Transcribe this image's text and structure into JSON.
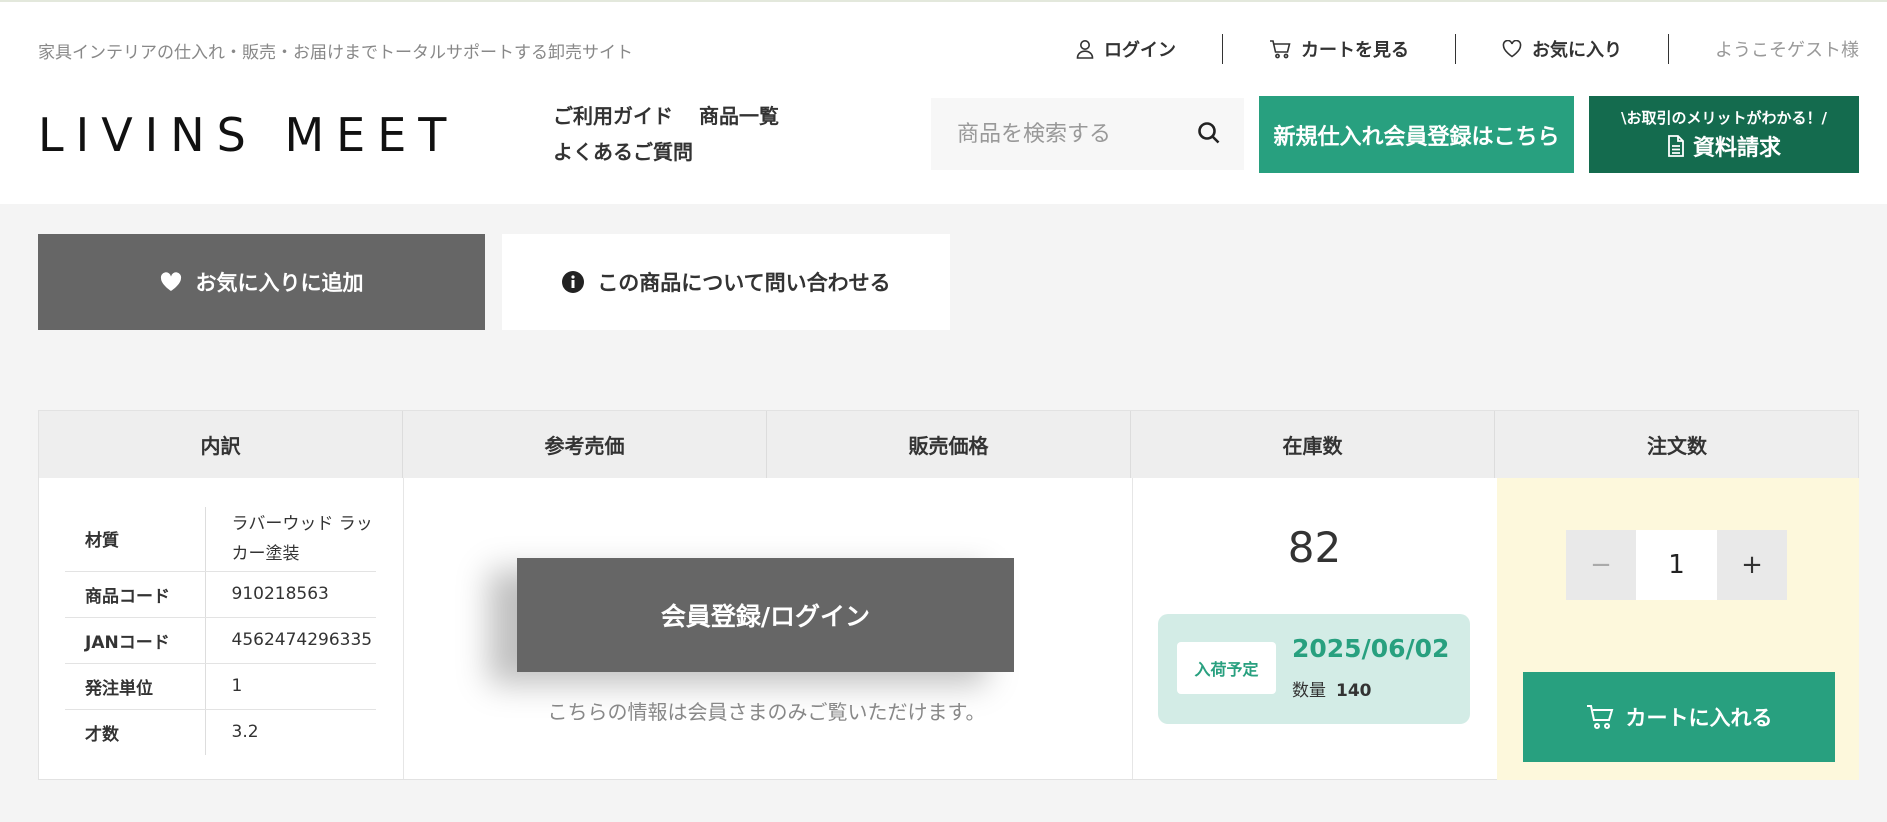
{
  "header": {
    "tagline": "家具インテリアの仕入れ・販売・お届けまでトータルサポートする卸売サイト",
    "logo_text": "LIVINS MEET",
    "util_nav": {
      "login": "ログイン",
      "cart": "カートを見る",
      "favorites": "お気に入り",
      "welcome": "ようこそゲスト様"
    },
    "main_nav": [
      "ご利用ガイド",
      "商品一覧",
      "よくあるご質問"
    ],
    "search": {
      "placeholder": "商品を検索する"
    },
    "register_button": "新規仕入れ会員登録はこちら",
    "docs_button": {
      "sub": "\\お取引のメリットがわかる！/",
      "main": "資料請求"
    }
  },
  "actions": {
    "favorite": "お気に入りに追加",
    "inquiry": "この商品について問い合わせる"
  },
  "table": {
    "headers": [
      "内訳",
      "参考売価",
      "販売価格",
      "在庫数",
      "注文数"
    ],
    "spec": [
      {
        "key": "材質",
        "value": "ラバーウッド ラッカー塗装"
      },
      {
        "key": "商品コード",
        "value": "910218563"
      },
      {
        "key": "JANコード",
        "value": "4562474296335"
      },
      {
        "key": "発注単位",
        "value": "1"
      },
      {
        "key": "才数",
        "value": "3.2"
      }
    ],
    "login_button": "会員登録/ログイン",
    "login_note": "こちらの情報は会員さまのみご覧いただけます。",
    "stock": "82",
    "arrival": {
      "badge": "入荷予定",
      "date": "2025/06/02",
      "qty_label": "数量",
      "qty": "140"
    },
    "order": {
      "minus": "−",
      "quantity": "1",
      "plus": "+",
      "cart_button": "カートに入れる"
    }
  },
  "colors": {
    "green": "#28a07f",
    "dark_green": "#146b4e",
    "gray_button": "#666666",
    "order_bg": "#fdf8dc",
    "arrival_bg": "#d3ece6"
  }
}
